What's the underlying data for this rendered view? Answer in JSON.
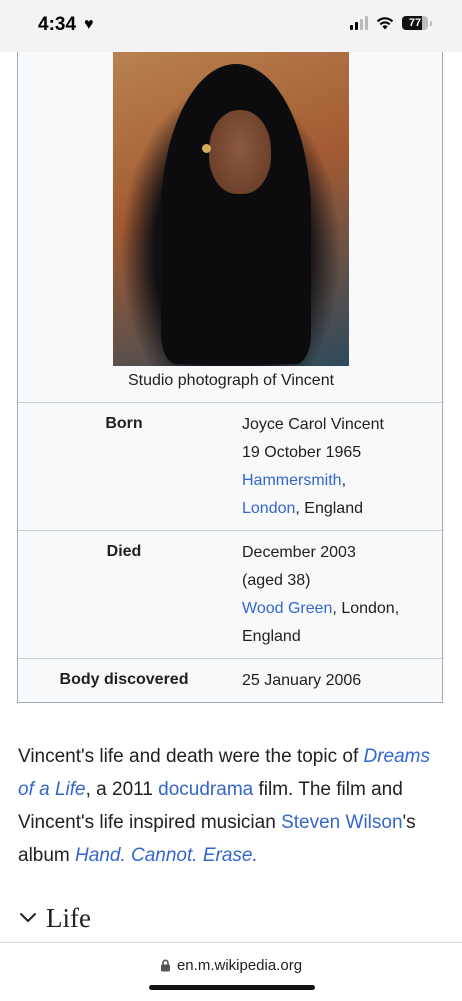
{
  "status_bar": {
    "time": "4:34",
    "battery": "77",
    "battery_level": 0.77,
    "signal_bars_active": 2,
    "signal_bars_total": 4,
    "icons": [
      "heart-icon",
      "cellular-signal-icon",
      "wifi-icon",
      "battery-icon"
    ]
  },
  "infobox": {
    "caption": "Studio photograph of Vincent",
    "rows": [
      {
        "label": "Born",
        "lines": [
          "Joyce Carol Vincent",
          "19 October 1965"
        ],
        "link1": "Hammersmith",
        "after_link1": ",",
        "link2": "London",
        "after_link2": ", England"
      },
      {
        "label": "Died",
        "lines": [
          "December 2003",
          "(aged 38)"
        ],
        "link1": "Wood Green",
        "after_link1": ", London,",
        "line_after": "England"
      },
      {
        "label": "Body discovered",
        "value": "25 January 2006"
      }
    ]
  },
  "paragraph": {
    "t1": "Vincent's life and death were the topic of ",
    "link1": "Dreams of a Life",
    "t2": ", a 2011 ",
    "link2": "docudrama",
    "t3": " film. The film and Vincent's life inspired musician ",
    "link3": "Steven Wilson",
    "t4": "'s album ",
    "link4": "Hand. Cannot. Erase.",
    "colors": {
      "text": "#202122",
      "link": "#3366cc"
    }
  },
  "section": {
    "title": "Life"
  },
  "browser": {
    "url": "en.m.wikipedia.org"
  }
}
